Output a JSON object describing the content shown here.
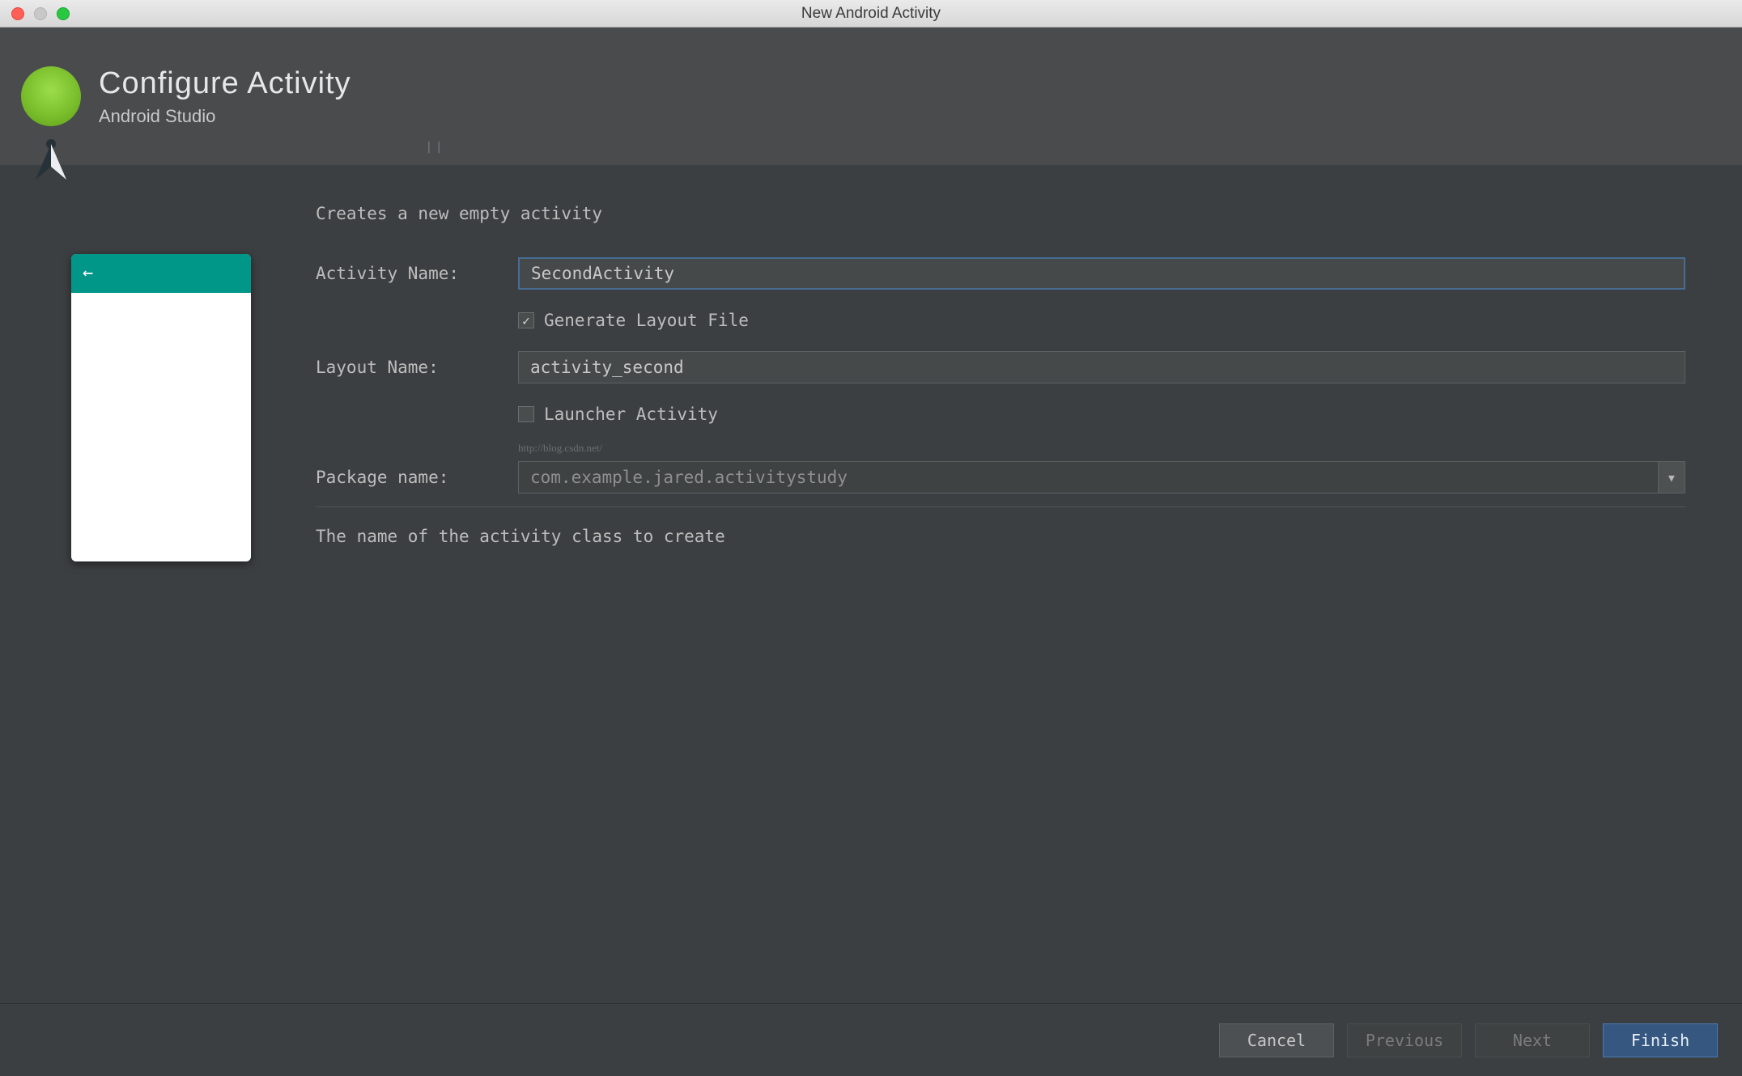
{
  "window": {
    "title": "New Android Activity"
  },
  "header": {
    "title": "Configure Activity",
    "subtitle": "Android Studio"
  },
  "form": {
    "intro": "Creates a new empty activity",
    "activity_name_label": "Activity Name:",
    "activity_name_value": "SecondActivity",
    "generate_layout_label": "Generate Layout File",
    "generate_layout_checked": true,
    "layout_name_label": "Layout Name:",
    "layout_name_value": "activity_second",
    "launcher_activity_label": "Launcher Activity",
    "launcher_activity_checked": false,
    "package_name_label": "Package name:",
    "package_name_value": "com.example.jared.activitystudy",
    "help_text": "The name of the activity class to create",
    "watermark": "http://blog.csdn.net/"
  },
  "buttons": {
    "cancel": "Cancel",
    "previous": "Previous",
    "next": "Next",
    "finish": "Finish"
  }
}
